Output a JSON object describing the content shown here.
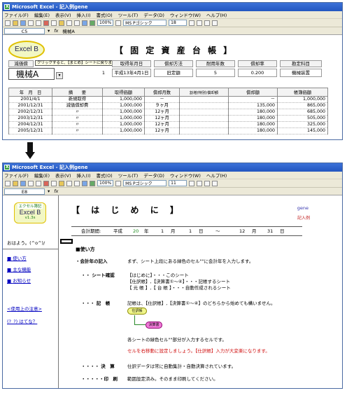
{
  "window1": {
    "title": "Microsoft Excel - 記入例gene",
    "menu": [
      "ファイル(F)",
      "編集(E)",
      "表示(V)",
      "挿入(I)",
      "書式(O)",
      "ツール(T)",
      "データ(D)",
      "ウィンドウ(W)",
      "ヘルプ(H)"
    ],
    "zoom": "100%",
    "font": "MS Pゴシック",
    "font_size": "18",
    "name_box": "C5",
    "formula": "機械A",
    "excel_b": "Excel B",
    "sheet_title": "【 固 定 資 産 台 帳 】",
    "tooltip": "クリックすると、【まとめ】シートに戻ります",
    "header_labels": [
      "減価償",
      "取得年月日",
      "償却方法",
      "耐用年数",
      "償却率",
      "勘定科目"
    ],
    "header_values": [
      "平成13年4月1日",
      "旧定額",
      "5",
      "0.200",
      "機械装置"
    ],
    "dept_value": "機械A",
    "row_number": "1",
    "table": {
      "columns": [
        "年　月　日",
        "摘　　要",
        "取得価額",
        "償却月数",
        "割増(特別)償却額",
        "償却額",
        "帳簿価額"
      ],
      "rows": [
        [
          "2001/4/1",
          "新規取得",
          "1,000,000",
          "－",
          "",
          "－",
          "1,000,000"
        ],
        [
          "2001/12/31",
          "減価償却費",
          "1,000,000",
          "９ヶ月",
          "",
          "135,000",
          "865,000"
        ],
        [
          "2002/12/31",
          "〃",
          "1,000,000",
          "12ヶ月",
          "",
          "180,000",
          "685,000"
        ],
        [
          "2003/12/31",
          "〃",
          "1,000,000",
          "12ヶ月",
          "",
          "180,000",
          "505,000"
        ],
        [
          "2004/12/31",
          "〃",
          "1,000,000",
          "12ヶ月",
          "",
          "180,000",
          "325,000"
        ],
        [
          "2005/12/31",
          "〃",
          "1,000,000",
          "12ヶ月",
          "",
          "180,000",
          "145,000"
        ]
      ]
    }
  },
  "window2": {
    "title": "Microsoft Excel - 記入例gene",
    "menu": [
      "ファイル(F)",
      "編集(E)",
      "表示(V)",
      "挿入(I)",
      "書式(O)",
      "ツール(T)",
      "データ(D)",
      "ウィンドウ(W)",
      "ヘルプ(H)"
    ],
    "zoom": "100%",
    "font": "MS Pゴシック",
    "font_size": "11",
    "name_box": "E8",
    "logo_top": "エクセル簿記",
    "logo_main": "Excel B",
    "logo_version": "v1.3s",
    "greeting": "おはよう。(^o^)/",
    "nav": [
      "使い方",
      "主な機能",
      "お知らせ",
      "<使用上の注意>",
      "(?_?) はてな？"
    ],
    "sheet_title": "【 は じ め に 】",
    "gene": "gene",
    "kinyu": "記入例",
    "period": {
      "label": "会計期間:",
      "era": "平成",
      "year": "20",
      "year_unit": "年",
      "m1": "1",
      "m_unit": "月",
      "d1": "1",
      "d_unit": "日",
      "tilde": "～",
      "m2": "12",
      "d2": "31"
    },
    "section": "■使い方",
    "items": {
      "year_label": "・会計年の記入",
      "year_text": "まず、シート上段にある緑色のセル\"\"に会計年を入力します。",
      "sheet_label": "・・ シート確認",
      "sheet_lines": [
        "【はじめに】・・・このシート",
        "【仕訳帳】,【決算書①～④】・・・記帳するシート",
        "【 元 帳 】,【 台 帳 】・・・自動作成されるシート"
      ],
      "kicho_label": "・・・ 記　帳",
      "kicho_text": "記帳は、【仕訳帳】,【決算書①～④】のどちらから始めても構いません。",
      "flow1": "仕訳帳",
      "flow2": "決算書",
      "note1": "各シートの緑色セル\"\"部分が入力するセルです。",
      "note2": "セルを右移動に設定しましょう。【仕訳帳】入力が大変楽になります。",
      "kessan_label": "・・・・ 決　算",
      "kessan_text": "仕訳データは常に自動集計・自動決算されています。",
      "print_label": "・・・・・印　刷",
      "print_text": "範囲設定済み。そのまま印刷してください。"
    }
  },
  "colors": {
    "title_bar": "#2356c0",
    "chrome": "#ece9d8",
    "link": "#0000c0",
    "accent_red": "#d01010",
    "accent_green": "#1a8a1a"
  }
}
